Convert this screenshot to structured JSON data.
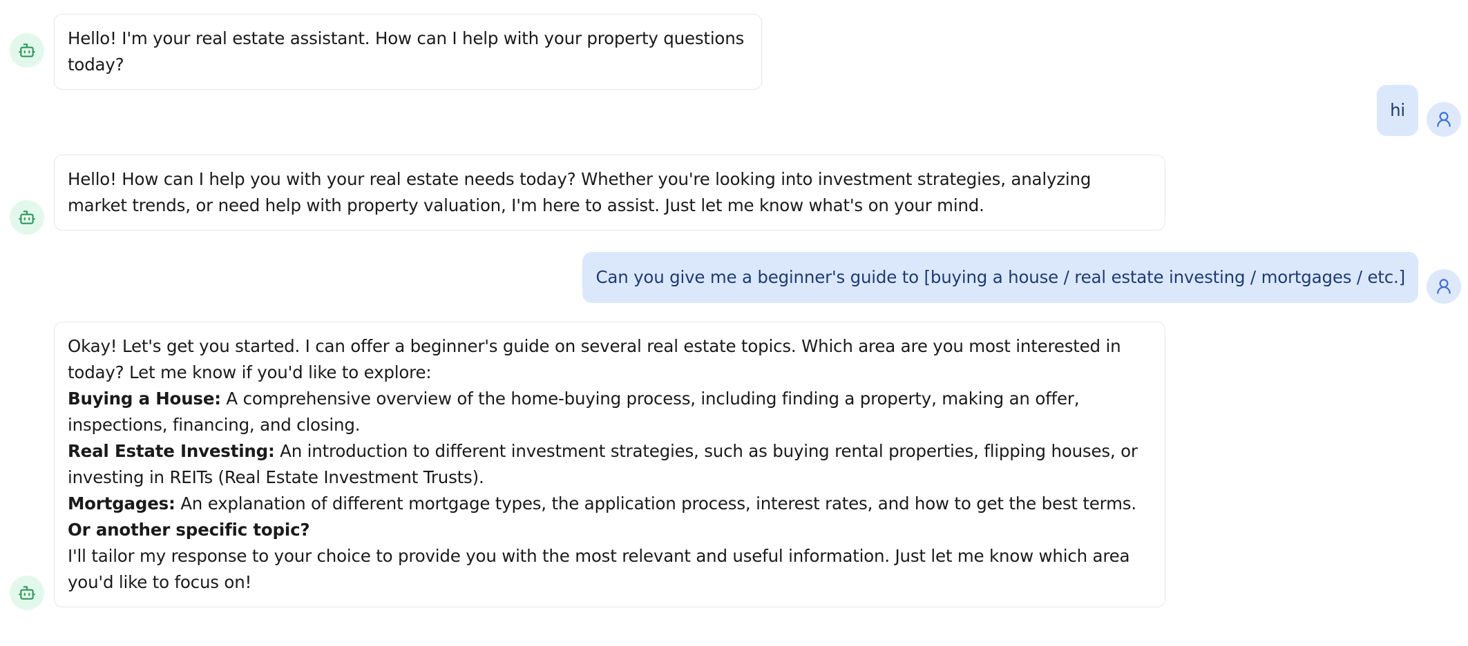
{
  "messages": {
    "m1": {
      "sender": "assistant",
      "text": "Hello! I'm your real estate assistant. How can I help with your property questions today?"
    },
    "m2": {
      "sender": "user",
      "text": "hi"
    },
    "m3": {
      "sender": "assistant",
      "text": "Hello! How can I help you with your real estate needs today? Whether you're looking into investment strategies, analyzing market trends, or need help with property valuation, I'm here to assist. Just let me know what's on your mind."
    },
    "m4": {
      "sender": "user",
      "text": "Can you give me a beginner's guide to [buying a house / real estate investing / mortgages / etc.]"
    },
    "m5": {
      "sender": "assistant",
      "intro": "Okay! Let's get you started. I can offer a beginner's guide on several real estate topics. Which area are you most interested in today? Let me know if you'd like to explore:",
      "options": [
        {
          "label": "Buying a House:",
          "text": " A comprehensive overview of the home-buying process, including finding a property, making an offer, inspections, financing, and closing."
        },
        {
          "label": "Real Estate Investing:",
          "text": " An introduction to different investment strategies, such as buying rental properties, flipping houses, or investing in REITs (Real Estate Investment Trusts)."
        },
        {
          "label": "Mortgages:",
          "text": " An explanation of different mortgage types, the application process, interest rates, and how to get the best terms."
        }
      ],
      "other_topic": "Or another specific topic?",
      "closing": "I'll tailor my response to your choice to provide you with the most relevant and useful information. Just let me know which area you'd like to focus on!"
    }
  },
  "icons": {
    "assistant_avatar": "robot-icon",
    "user_avatar": "user-icon"
  },
  "colors": {
    "assistant_avatar_bg": "#e3f8ec",
    "assistant_icon": "#2e9a5c",
    "user_avatar_bg": "#dde8fb",
    "user_icon": "#3b6fd1",
    "user_bubble_bg": "#dbe8fc",
    "user_text": "#1f3b73",
    "assistant_bubble_border": "#e6e7ea"
  }
}
